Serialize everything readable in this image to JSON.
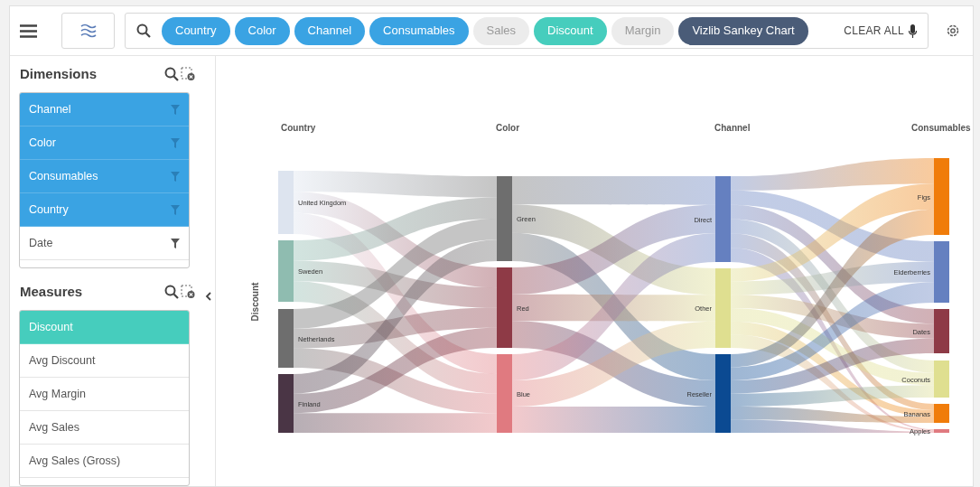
{
  "toolbar": {
    "chips": [
      {
        "label": "Country",
        "kind": "dimension",
        "selected": true
      },
      {
        "label": "Color",
        "kind": "dimension",
        "selected": true
      },
      {
        "label": "Channel",
        "kind": "dimension",
        "selected": true
      },
      {
        "label": "Consumables",
        "kind": "dimension",
        "selected": true
      },
      {
        "label": "Sales",
        "kind": "measure",
        "selected": false
      },
      {
        "label": "Discount",
        "kind": "measure",
        "selected": true
      },
      {
        "label": "Margin",
        "kind": "measure",
        "selected": false
      },
      {
        "label": "Vizlib Sankey Chart",
        "kind": "chart",
        "selected": true
      }
    ],
    "clear_all": "CLEAR ALL"
  },
  "sidebar": {
    "dimensions": {
      "title": "Dimensions",
      "items": [
        {
          "label": "Channel",
          "selected": true
        },
        {
          "label": "Color",
          "selected": true
        },
        {
          "label": "Consumables",
          "selected": true
        },
        {
          "label": "Country",
          "selected": true
        },
        {
          "label": "Date",
          "selected": false
        }
      ]
    },
    "measures": {
      "title": "Measures",
      "items": [
        {
          "label": "Discount",
          "selected": true
        },
        {
          "label": "Avg Discount",
          "selected": false
        },
        {
          "label": "Avg Margin",
          "selected": false
        },
        {
          "label": "Avg Sales",
          "selected": false
        },
        {
          "label": "Avg Sales (Gross)",
          "selected": false
        }
      ]
    }
  },
  "sankey": {
    "axis_title": "Discount",
    "columns": [
      {
        "title": "Country",
        "nodes": [
          {
            "label": "United Kingdom",
            "color": "#dde4ef"
          },
          {
            "label": "Sweden",
            "color": "#8fbcb0"
          },
          {
            "label": "Netherlands",
            "color": "#6e6e6e"
          },
          {
            "label": "Finland",
            "color": "#4a3545"
          }
        ]
      },
      {
        "title": "Color",
        "nodes": [
          {
            "label": "Green",
            "color": "#6e6e6e"
          },
          {
            "label": "Red",
            "color": "#8e3a46"
          },
          {
            "label": "Blue",
            "color": "#e07a80"
          }
        ]
      },
      {
        "title": "Channel",
        "nodes": [
          {
            "label": "Direct",
            "color": "#6580c0"
          },
          {
            "label": "Other",
            "color": "#dfdf90"
          },
          {
            "label": "Reseller",
            "color": "#0b4a92"
          }
        ]
      },
      {
        "title": "Consumables",
        "nodes": [
          {
            "label": "Figs",
            "color": "#f07c0a"
          },
          {
            "label": "Elderberries",
            "color": "#6580c0"
          },
          {
            "label": "Dates",
            "color": "#8e3a46"
          },
          {
            "label": "Coconuts",
            "color": "#dfdf90"
          },
          {
            "label": "Bananas",
            "color": "#f07c0a"
          },
          {
            "label": "Apples",
            "color": "#e07a80"
          }
        ]
      }
    ]
  }
}
